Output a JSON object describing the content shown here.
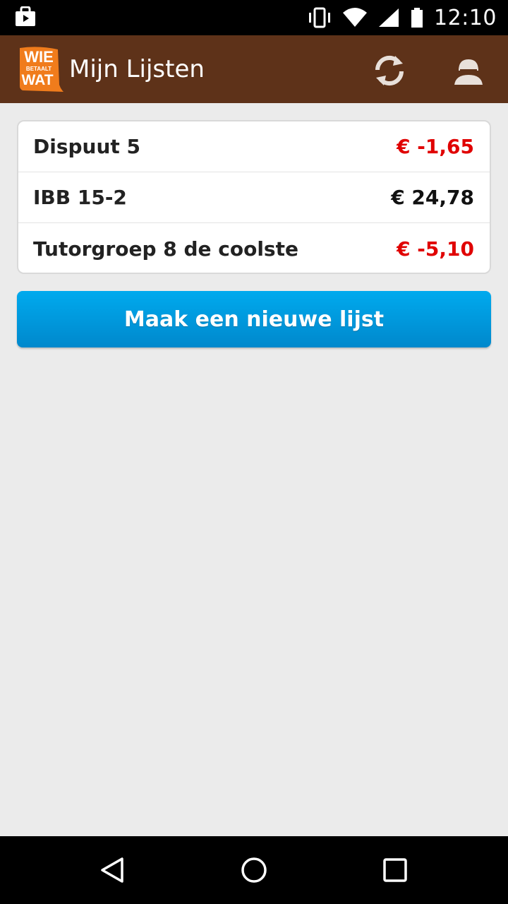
{
  "status_bar": {
    "time": "12:10",
    "icons": [
      "shopping-bag-icon",
      "vibrate-icon",
      "wifi-icon",
      "signal-icon",
      "battery-icon"
    ]
  },
  "app_bar": {
    "title": "Mijn Lijsten",
    "logo_top": "WIE",
    "logo_middle": "BETAALT",
    "logo_bottom": "WAT",
    "icons": [
      "refresh-icon",
      "profile-icon"
    ]
  },
  "lists": [
    {
      "name": "Dispuut 5",
      "amount": "€ -1,65",
      "negative": true
    },
    {
      "name": "IBB 15-2",
      "amount": "€ 24,78",
      "negative": false
    },
    {
      "name": "Tutorgroep 8 de coolste",
      "amount": "€ -5,10",
      "negative": true
    }
  ],
  "new_list_button": "Maak een nieuwe lijst",
  "colors": {
    "app_bar": "#5e3219",
    "negative": "#e00000",
    "button": "#0099dd",
    "background": "#ebebeb"
  },
  "nav_bar": {
    "icons": [
      "back-icon",
      "home-icon",
      "recents-icon"
    ]
  }
}
